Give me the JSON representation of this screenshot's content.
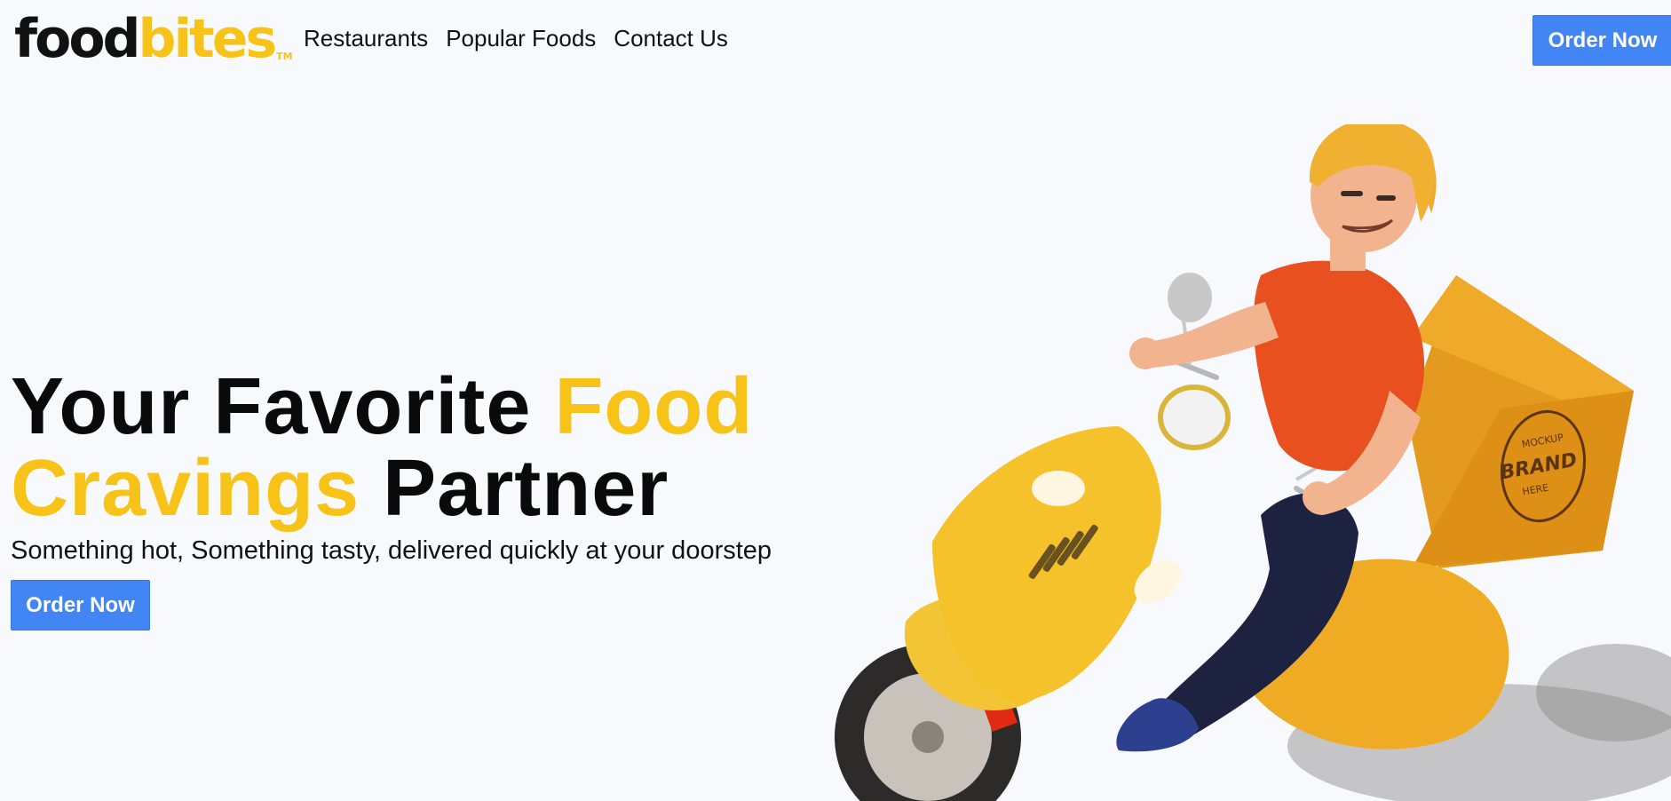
{
  "brand": {
    "part1": "food",
    "part2": "bites",
    "tm": "TM"
  },
  "nav": {
    "links": [
      "Restaurants",
      "Popular Foods",
      "Contact Us"
    ],
    "cta_label": "Order Now"
  },
  "hero": {
    "title_part1": "Your Favorite ",
    "title_highlight1": "Food",
    "title_highlight2": "Cravings",
    "title_part2": " Partner",
    "subtitle": "Something hot, Something tasty, delivered quickly at your doorstep",
    "cta_label": "Order Now"
  },
  "illustration": {
    "box_text_top": "MOCKUP",
    "box_text_mid": "BRAND",
    "box_text_bottom": "HERE"
  },
  "colors": {
    "accent": "#f7c318",
    "button": "#4285f4",
    "background": "#f8f9fd"
  }
}
